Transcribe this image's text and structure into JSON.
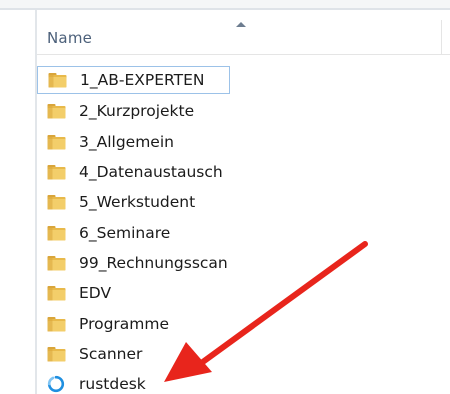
{
  "header": {
    "name_label": "Name"
  },
  "items": [
    {
      "label": "1_AB-EXPERTEN",
      "icon": "folder-icon"
    },
    {
      "label": "2_Kurzprojekte",
      "icon": "folder-icon"
    },
    {
      "label": "3_Allgemein",
      "icon": "folder-icon"
    },
    {
      "label": "4_Datenaustausch",
      "icon": "folder-icon"
    },
    {
      "label": "5_Werkstudent",
      "icon": "folder-icon"
    },
    {
      "label": "6_Seminare",
      "icon": "folder-icon"
    },
    {
      "label": "99_Rechnungsscan",
      "icon": "folder-icon"
    },
    {
      "label": "EDV",
      "icon": "folder-icon"
    },
    {
      "label": "Programme",
      "icon": "folder-icon"
    },
    {
      "label": "Scanner",
      "icon": "folder-icon"
    },
    {
      "label": "rustdesk",
      "icon": "rustdesk-app-icon"
    }
  ],
  "colors": {
    "folder": "#e8b94a",
    "arrow": "#e8251c",
    "rustdesk": "#1f8fe0",
    "header_text": "#4c607a"
  }
}
